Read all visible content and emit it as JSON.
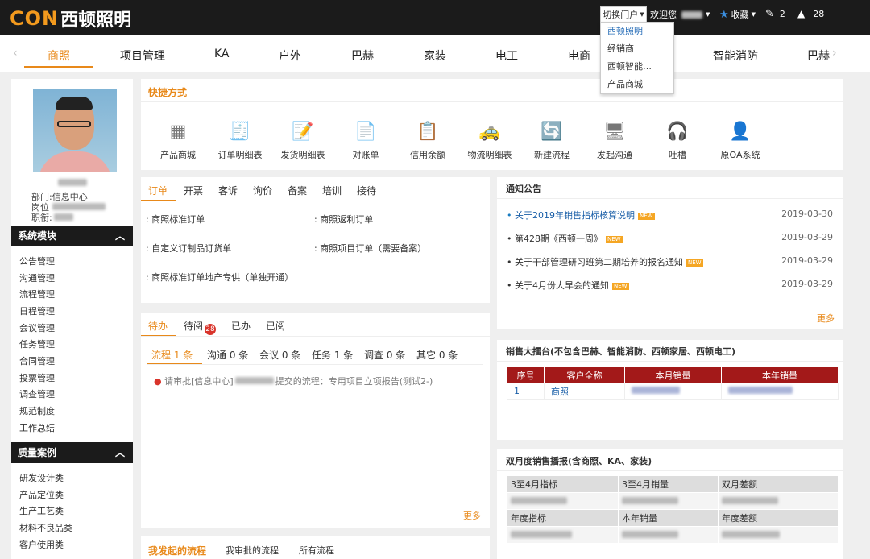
{
  "header": {
    "logo_mark": "CON",
    "logo_text": "西顿照明",
    "portal_switch": "切换门户",
    "welcome": "欢迎您",
    "favorites": "收藏",
    "edit_count": "2",
    "alert_count": "28"
  },
  "portal_menu": [
    "西顿照明",
    "经销商",
    "西顿智能…",
    "产品商城"
  ],
  "nav": [
    "商照",
    "项目管理",
    "KA",
    "户外",
    "巴赫",
    "家装",
    "电工",
    "电商",
    "智能消防",
    "巴赫"
  ],
  "profile": {
    "dept": "部门:信息中心",
    "post": "岗位",
    "rank": "职衔:"
  },
  "sidebar": {
    "system_title": "系统模块",
    "system_items": [
      "公告管理",
      "沟通管理",
      "流程管理",
      "日程管理",
      "会议管理",
      "任务管理",
      "合同管理",
      "投票管理",
      "调查管理",
      "规范制度",
      "工作总结"
    ],
    "quality_title": "质量案例",
    "quality_items": [
      "研发设计类",
      "产品定位类",
      "生产工艺类",
      "材料不良品类",
      "客户使用类"
    ]
  },
  "shortcuts": {
    "title": "快捷方式",
    "items": [
      "产品商城",
      "订单明细表",
      "发货明细表",
      "对账单",
      "信用余额",
      "物流明细表",
      "新建流程",
      "发起沟通",
      "吐槽",
      "原OA系统"
    ]
  },
  "orders": {
    "tabs": [
      "订单",
      "开票",
      "客诉",
      "询价",
      "备案",
      "培训",
      "接待"
    ],
    "links": [
      "商照标准订单",
      "商照返利订单",
      "自定义订制品订货单",
      "商照项目订单（需要备案）",
      "商照标准订单地产专供（单独开通）"
    ]
  },
  "todo": {
    "tabs": [
      "待办",
      "待阅",
      "已办",
      "已阅"
    ],
    "badge": "28",
    "subtabs": [
      "流程 1 条",
      "沟通 0 条",
      "会议 0 条",
      "任务 1 条",
      "调查 0 条",
      "其它 0 条"
    ],
    "item_prefix": "请审批[信息中心]",
    "item_suffix": "提交的流程：专用项目立项报告(测试2-)",
    "more": "更多"
  },
  "flows": {
    "tabs": [
      "我发起的流程",
      "我审批的流程",
      "所有流程"
    ]
  },
  "notices": {
    "title": "通知公告",
    "items": [
      {
        "text": "关于2019年销售指标核算说明",
        "date": "2019-03-30",
        "new": "NEW"
      },
      {
        "text": "第428期《西顿一周》",
        "date": "2019-03-29",
        "new": "NEW"
      },
      {
        "text": "关于干部管理研习班第二期培养的报名通知",
        "date": "2019-03-29",
        "new": "NEW"
      },
      {
        "text": "关于4月份大早会的通知",
        "date": "2019-03-29",
        "new": "NEW"
      }
    ],
    "more": "更多"
  },
  "sales_board": {
    "title": "销售大擂台(不包含巴赫、智能消防、西顿家居、西顿电工)",
    "headers": [
      "序号",
      "客户全称",
      "本月销量",
      "本年销量"
    ],
    "rows": [
      [
        "1",
        "商照",
        "",
        ""
      ]
    ]
  },
  "bimonthly": {
    "title": "双月度销售播报(含商照、KA、家装)",
    "row1": [
      "3至4月指标",
      "3至4月销量",
      "双月差额"
    ],
    "row2": [
      "年度指标",
      "本年销量",
      "年度差额"
    ]
  }
}
